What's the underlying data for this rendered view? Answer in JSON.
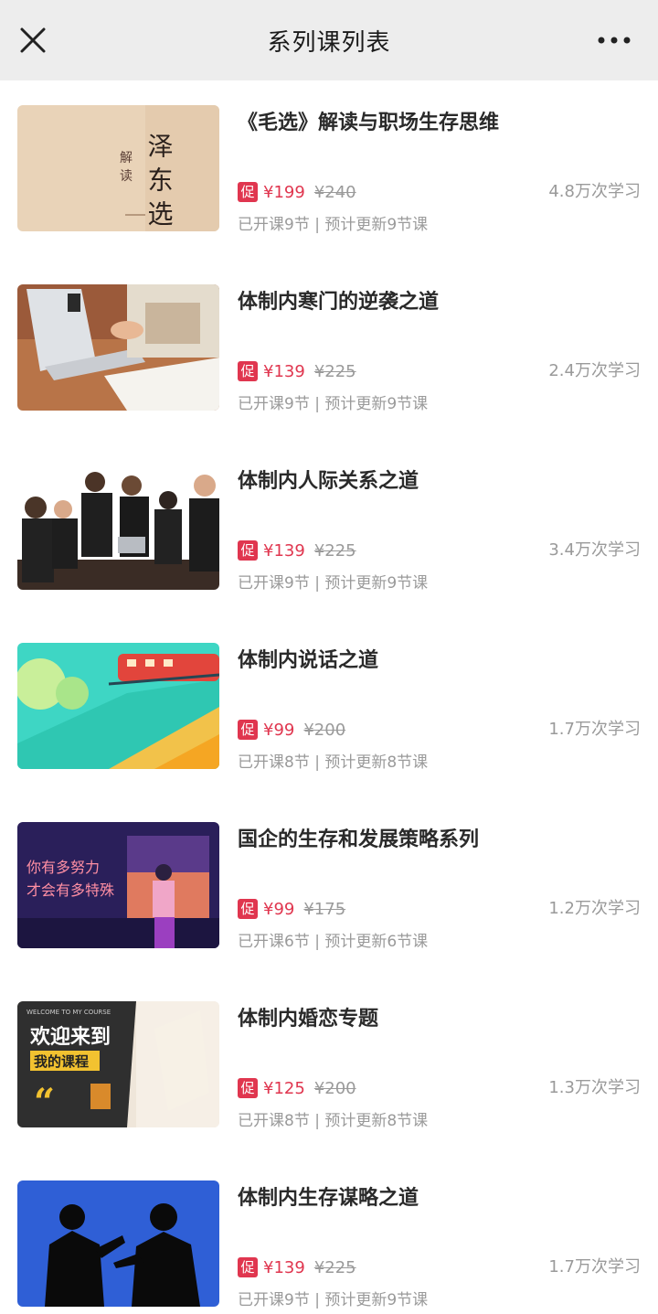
{
  "header": {
    "title": "系列课列表",
    "close_icon": "close-icon",
    "more_icon": "more-icon"
  },
  "promo_label": "促",
  "courses": [
    {
      "title": "《毛选》解读与职场生存思维",
      "price": "¥199",
      "original_price": "¥240",
      "learners": "4.8万次学习",
      "meta": "已开课9节 | 预计更新9节课",
      "thumb_text": [
        "解",
        "读",
        "泽 东 选"
      ]
    },
    {
      "title": "体制内寒门的逆袭之道",
      "price": "¥139",
      "original_price": "¥225",
      "learners": "2.4万次学习",
      "meta": "已开课9节 | 预计更新9节课"
    },
    {
      "title": "体制内人际关系之道",
      "price": "¥139",
      "original_price": "¥225",
      "learners": "3.4万次学习",
      "meta": "已开课9节 | 预计更新9节课"
    },
    {
      "title": "体制内说话之道",
      "price": "¥99",
      "original_price": "¥200",
      "learners": "1.7万次学习",
      "meta": "已开课8节 | 预计更新8节课"
    },
    {
      "title": "国企的生存和发展策略系列",
      "price": "¥99",
      "original_price": "¥175",
      "learners": "1.2万次学习",
      "meta": "已开课6节 | 预计更新6节课",
      "thumb_text": [
        "你有多努力",
        "才会有多特殊"
      ]
    },
    {
      "title": "体制内婚恋专题",
      "price": "¥125",
      "original_price": "¥200",
      "learners": "1.3万次学习",
      "meta": "已开课8节 | 预计更新8节课",
      "thumb_text": [
        "WELCOME TO MY COURSE",
        "欢迎来到",
        "我的课程"
      ]
    },
    {
      "title": "体制内生存谋略之道",
      "price": "¥139",
      "original_price": "¥225",
      "learners": "1.7万次学习",
      "meta": "已开课9节 | 预计更新9节课"
    }
  ],
  "colors": {
    "header_bg": "#ededed",
    "promo_red": "#e0364f",
    "gray_text": "#9a9a9a"
  }
}
